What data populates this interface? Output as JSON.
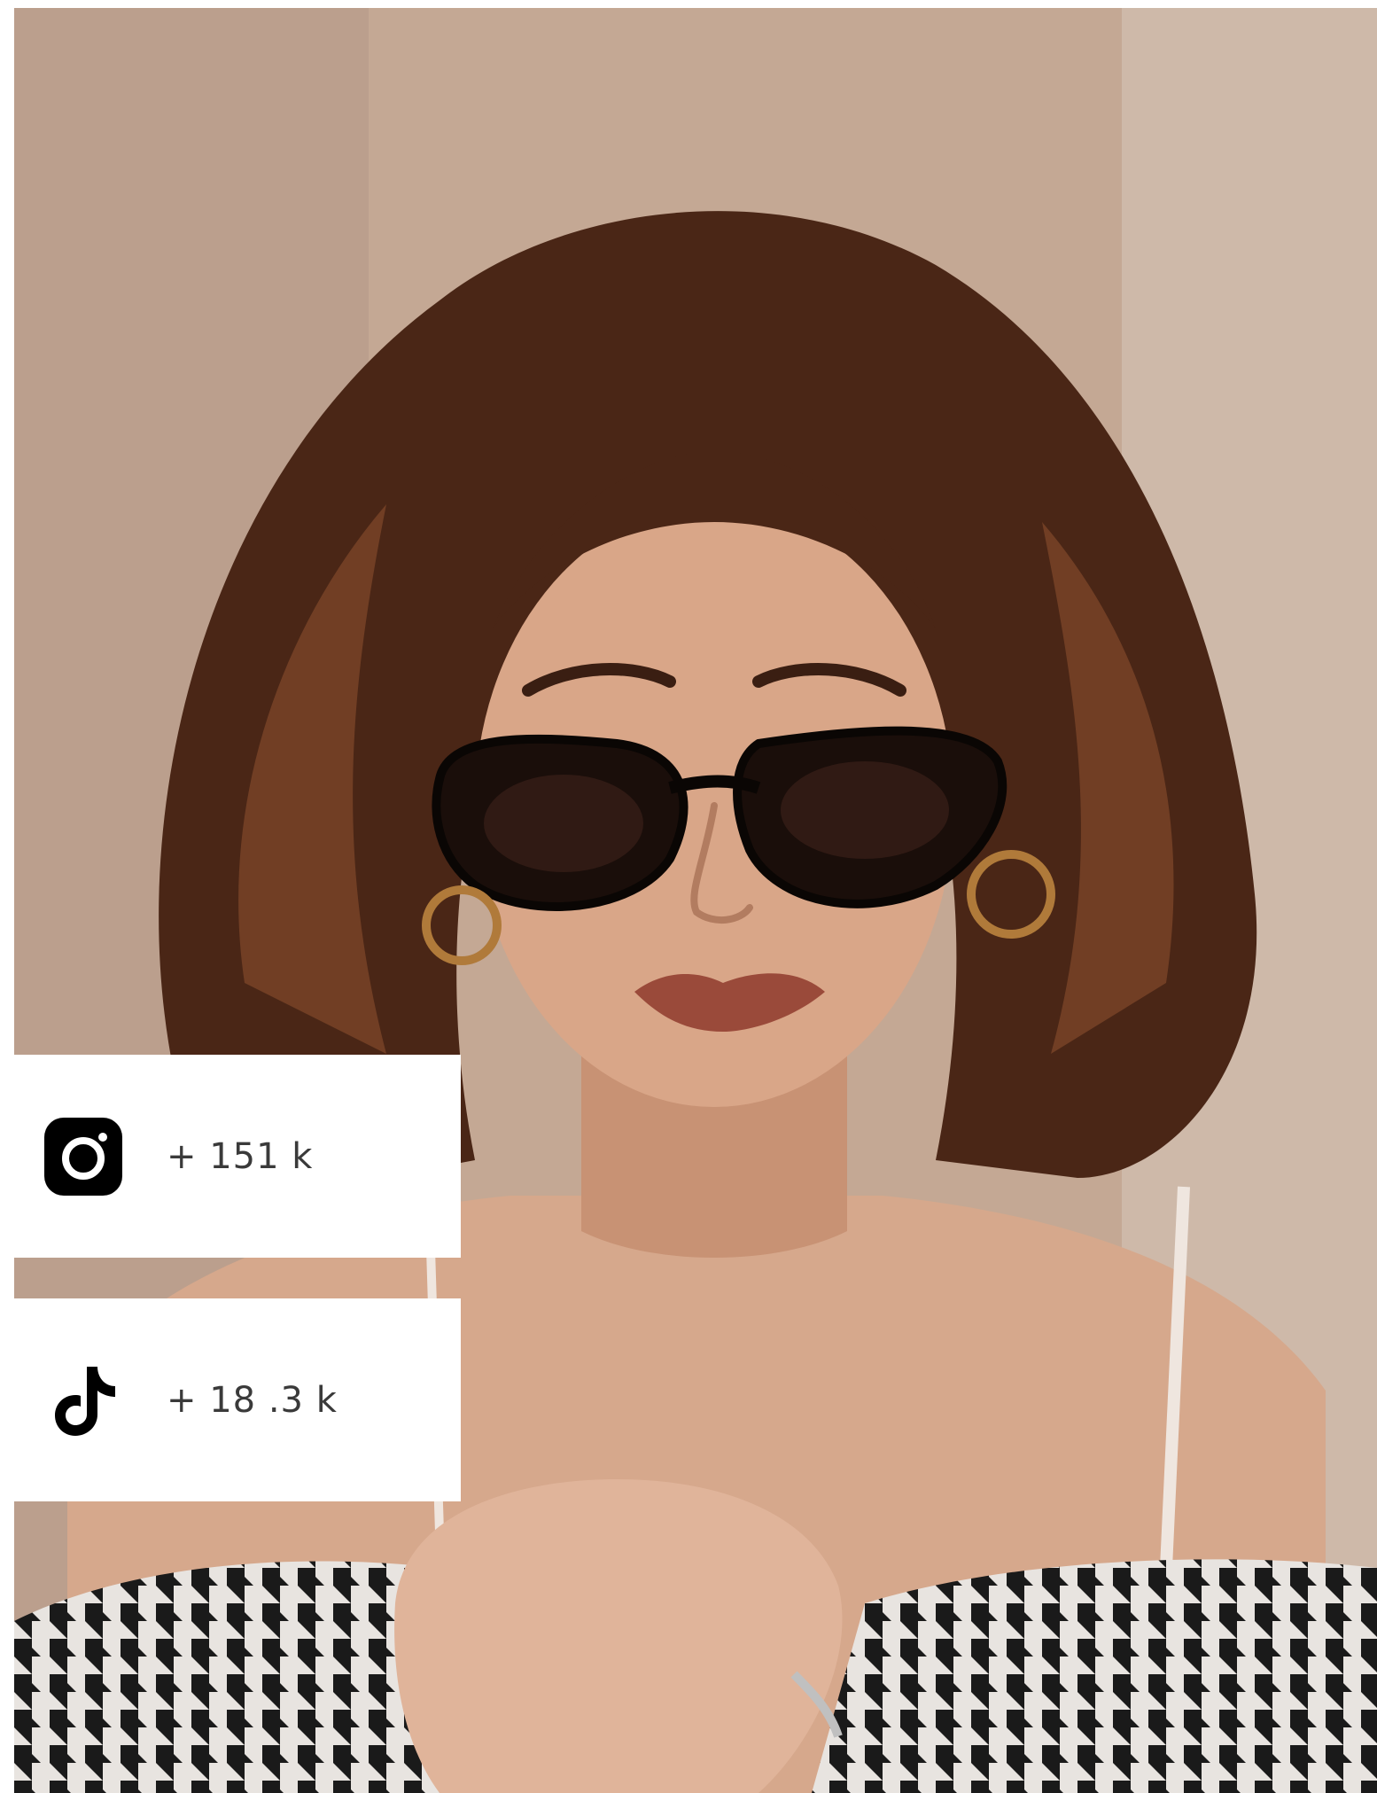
{
  "stats": {
    "instagram": {
      "icon": "instagram-icon",
      "value": "+ 151 k"
    },
    "tiktok": {
      "icon": "tiktok-icon",
      "value": "+ 18 .3 k"
    }
  },
  "colors": {
    "card_background": "#ffffff",
    "text": "#3a3a3a",
    "icon": "#000000"
  }
}
